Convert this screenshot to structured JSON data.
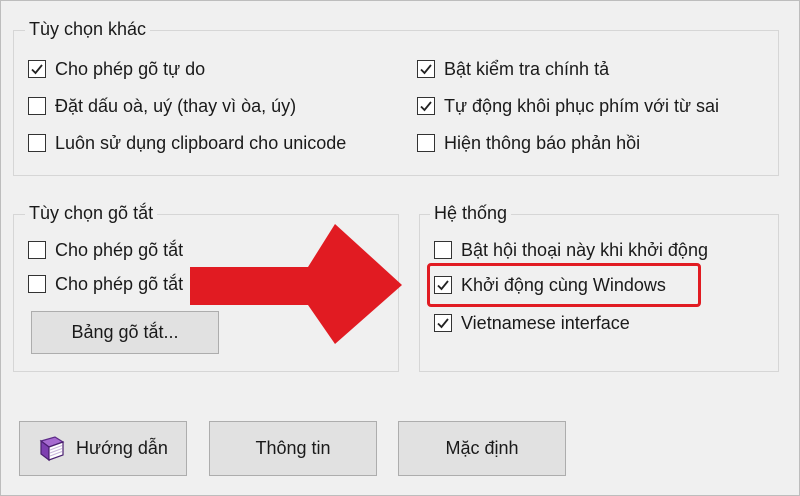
{
  "other_options": {
    "title": "Tùy chọn khác",
    "items": [
      {
        "label": "Cho phép gõ tự do",
        "checked": true
      },
      {
        "label": "Đặt dấu oà, uý (thay vì òa, úy)",
        "checked": false
      },
      {
        "label": "Luôn sử dụng clipboard cho unicode",
        "checked": false
      },
      {
        "label": "Bật kiểm tra chính tả",
        "checked": true
      },
      {
        "label": "Tự động khôi phục phím với từ sai",
        "checked": true
      },
      {
        "label": "Hiện thông báo phản hồi",
        "checked": false
      }
    ]
  },
  "shortcut_options": {
    "title": "Tùy chọn gõ tắt",
    "items": [
      {
        "label": "Cho phép gõ tắt",
        "checked": false
      },
      {
        "label": "Cho phép gõ tắt",
        "checked": false
      }
    ],
    "table_button": "Bảng gõ tắt..."
  },
  "system": {
    "title": "Hệ thống",
    "items": [
      {
        "label": "Bật hội thoại này khi khởi động",
        "checked": false
      },
      {
        "label": "Khởi động cùng Windows",
        "checked": true
      },
      {
        "label": "Vietnamese interface",
        "checked": true
      }
    ]
  },
  "buttons": {
    "guide": "Hướng dẫn",
    "info": "Thông tin",
    "default": "Mặc định"
  },
  "annotation": {
    "arrow_color": "#e11b22",
    "highlight_color": "#e11b22"
  }
}
